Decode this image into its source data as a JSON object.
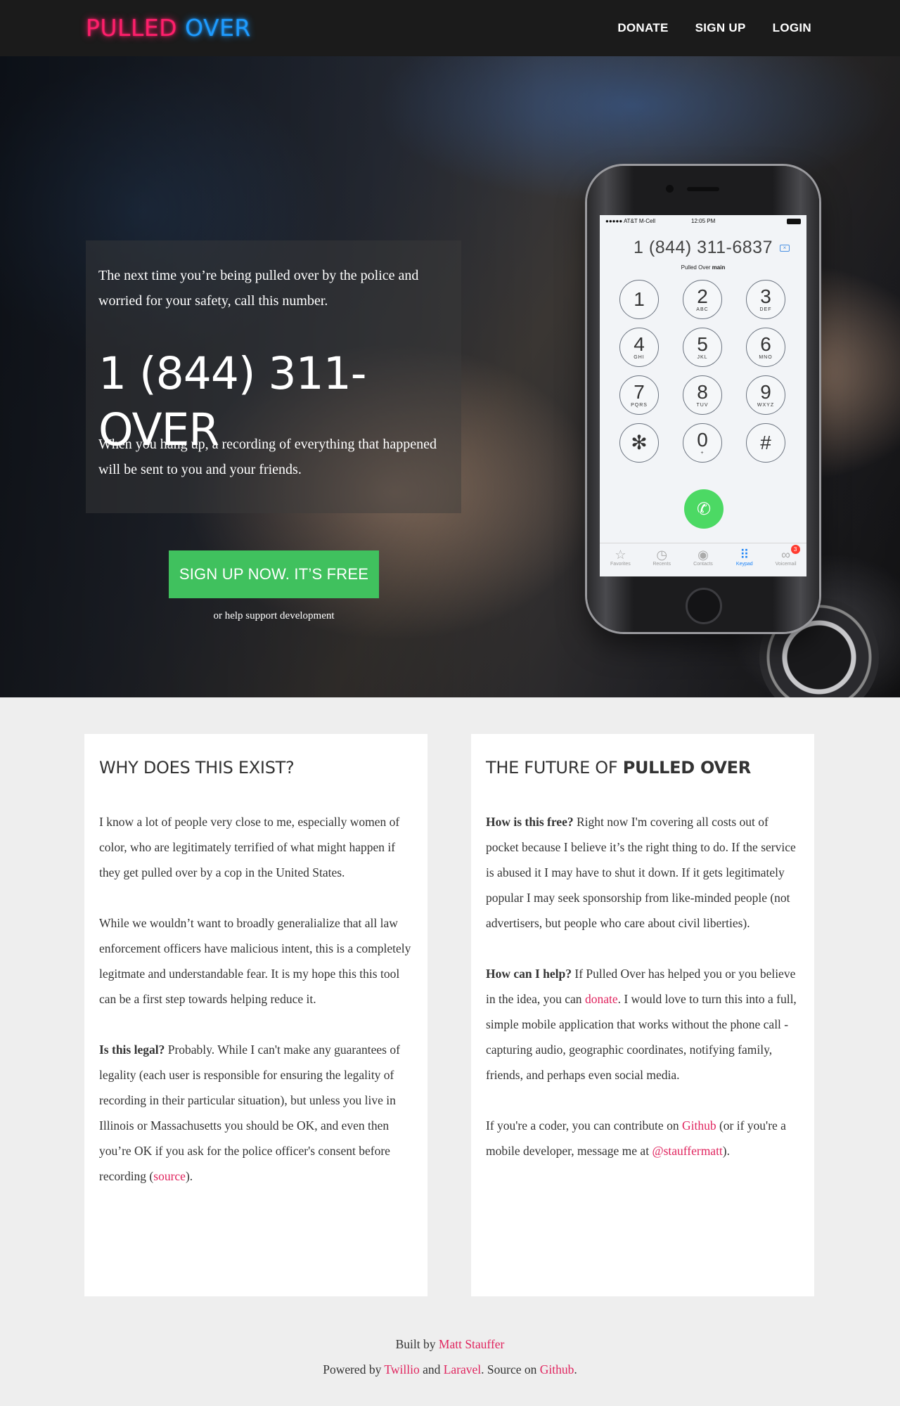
{
  "nav": {
    "logo_word1": "PULLED",
    "logo_word2": "OVER",
    "links": [
      "DONATE",
      "SIGN UP",
      "LOGIN"
    ]
  },
  "hero": {
    "lead": "The next time you’re being pulled over by the police and worried for your safety, call this number.",
    "number": "1 (844) 311-OVER",
    "tail": "When you hang up, a recording of everything that happened will be sent to you and your friends.",
    "cta": "SIGN UP NOW. IT’S FREE",
    "support": "or help support development"
  },
  "phone": {
    "carrier": "●●●●● AT&T M-Cell",
    "time": "12:05 PM",
    "dialed": "1 (844) 311-6837",
    "contact_label": "Pulled Over",
    "contact_type": "main",
    "keys": [
      {
        "d": "1",
        "l": ""
      },
      {
        "d": "2",
        "l": "ABC"
      },
      {
        "d": "3",
        "l": "DEF"
      },
      {
        "d": "4",
        "l": "GHI"
      },
      {
        "d": "5",
        "l": "JKL"
      },
      {
        "d": "6",
        "l": "MNO"
      },
      {
        "d": "7",
        "l": "PQRS"
      },
      {
        "d": "8",
        "l": "TUV"
      },
      {
        "d": "9",
        "l": "WXYZ"
      },
      {
        "d": "✻",
        "l": ""
      },
      {
        "d": "0",
        "l": "+"
      },
      {
        "d": "#",
        "l": ""
      }
    ],
    "tabs": [
      "Favorites",
      "Recents",
      "Contacts",
      "Keypad",
      "Voicemail"
    ],
    "voicemail_badge": "3"
  },
  "why": {
    "title": "WHY DOES THIS EXIST?",
    "p1": "I know a lot of people very close to me, especially women of color, who are legitimately terrified of what might happen if they get pulled over by a cop in the United States.",
    "p2": "While we wouldn’t want to broadly generalialize that all law enforcement officers have malicious intent, this is a completely legitmate and understandable fear. It is my hope this this tool can be a first step towards helping reduce it.",
    "p3_bold": "Is this legal?",
    "p3": " Probably. While I can't make any guarantees of legality (each user is responsible for ensuring the legality of recording in their particular situation), but unless you live in Illinois or Massachusetts you should be OK, and even then you’re OK if you ask for the police officer's consent before recording (",
    "p3_link": "source",
    "p3_end": ")."
  },
  "future": {
    "title_light": "THE FUTURE OF ",
    "title_bold": "PULLED OVER",
    "p1_bold": "How is this free?",
    "p1": " Right now I'm covering all costs out of pocket because I believe it’s the right thing to do. If the service is abused it I may have to shut it down. If it gets legitimately popular I may seek sponsorship from like-minded people (not advertisers, but people who care about civil liberties).",
    "p2_bold": "How can I help?",
    "p2a": " If Pulled Over has helped you or you believe in the idea, you can ",
    "p2_link": "donate",
    "p2b": ". I would love to turn this into a full, simple mobile application that works without the phone call - capturing audio, geographic coordinates, notifying family, friends, and perhaps even social media.",
    "p3a": "If you're a coder, you can contribute on ",
    "p3_link1": "Github",
    "p3b": " (or if you're a mobile developer, message me at ",
    "p3_link2": "@stauffermatt",
    "p3c": ")."
  },
  "footer": {
    "built_by": "Built by ",
    "author": "Matt Stauffer",
    "powered": "Powered by ",
    "twilio": "Twillio",
    "and": " and ",
    "laravel": "Laravel",
    "source": ". Source on ",
    "github": "Github",
    "end": "."
  }
}
